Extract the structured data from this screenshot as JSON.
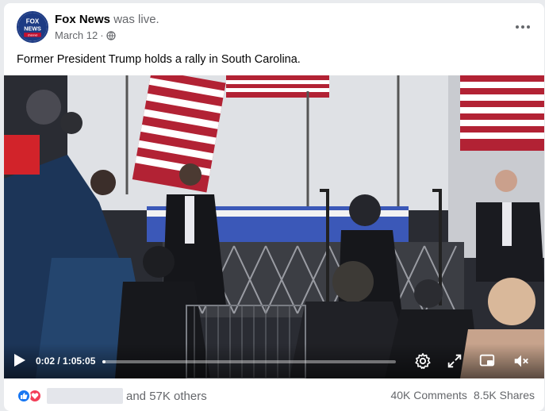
{
  "post": {
    "page_name": "Fox News",
    "status": "was live.",
    "date": "March 12",
    "separator": "·",
    "caption": "Former President Trump holds a rally in South Carolina.",
    "avatar_text_1": "FOX",
    "avatar_text_2": "NEWS",
    "avatar_text_3": "channel"
  },
  "video": {
    "current_time": "0:02",
    "duration": "1:05:05",
    "time_separator": " / ",
    "progress_fraction": 0.01
  },
  "icons": {
    "more": "more-horizontal-icon",
    "privacy": "globe-icon",
    "play": "play-icon",
    "settings": "gear-icon",
    "fullscreen": "expand-icon",
    "pip": "picture-in-picture-icon",
    "mute": "volume-muted-icon",
    "like": "like-icon",
    "love": "heart-icon"
  },
  "footer": {
    "others_text": "and 57K others",
    "comments": "40K Comments",
    "shares": "8.5K Shares"
  },
  "colors": {
    "brand_blue": "#1877f2",
    "love_red": "#f33e58",
    "secondary_text": "#65676b"
  }
}
